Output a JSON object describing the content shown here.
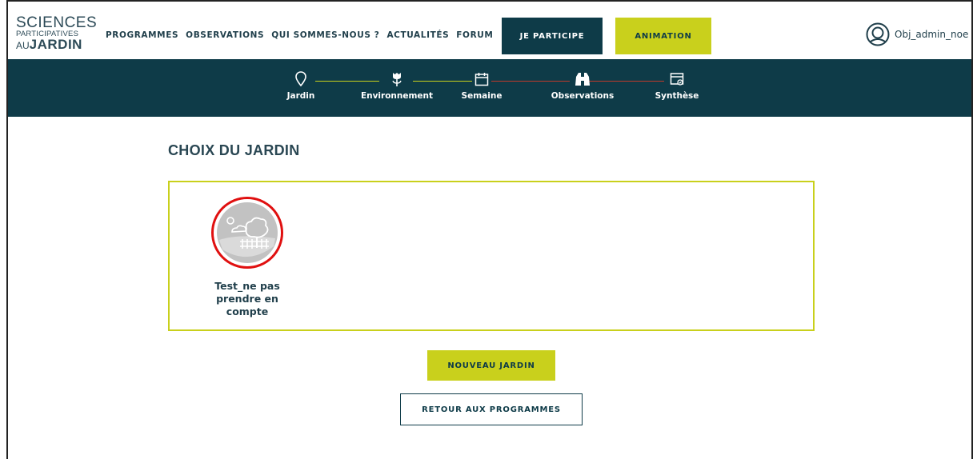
{
  "logo": {
    "line1": "SCIENCES",
    "line2": "PARTICIPATIVES",
    "line3_prefix": "AU",
    "line3_bold": "JARDIN"
  },
  "nav": {
    "items": [
      {
        "label": "PROGRAMMES"
      },
      {
        "label": "OBSERVATIONS"
      },
      {
        "label": "QUI SOMMES-NOUS ?"
      },
      {
        "label": "ACTUALITÉS"
      },
      {
        "label": "FORUM"
      }
    ],
    "participe_label": "JE PARTICIPE",
    "animation_label": "ANIMATION"
  },
  "user": {
    "name": "Obj_admin_noe",
    "icon": "user-circle-icon"
  },
  "steps": {
    "items": [
      {
        "label": "Jardin",
        "icon": "map-pin-icon"
      },
      {
        "label": "Environnement",
        "icon": "flower-icon"
      },
      {
        "label": "Semaine",
        "icon": "calendar-icon"
      },
      {
        "label": "Observations",
        "icon": "binoculars-icon"
      },
      {
        "label": "Synthèse",
        "icon": "summary-icon"
      }
    ],
    "colors": {
      "done": "#c9d01c",
      "pending": "#c0392b"
    }
  },
  "page": {
    "title": "CHOIX DU JARDIN"
  },
  "gardens": [
    {
      "name": "Test_ne pas prendre en compte",
      "icon": "garden-icon"
    }
  ],
  "actions": {
    "new_garden": "NOUVEAU JARDIN",
    "back": "RETOUR AUX PROGRAMMES"
  },
  "colors": {
    "primary": "#0e3b48",
    "accent": "#c9d01c",
    "highlight": "#e01010"
  }
}
